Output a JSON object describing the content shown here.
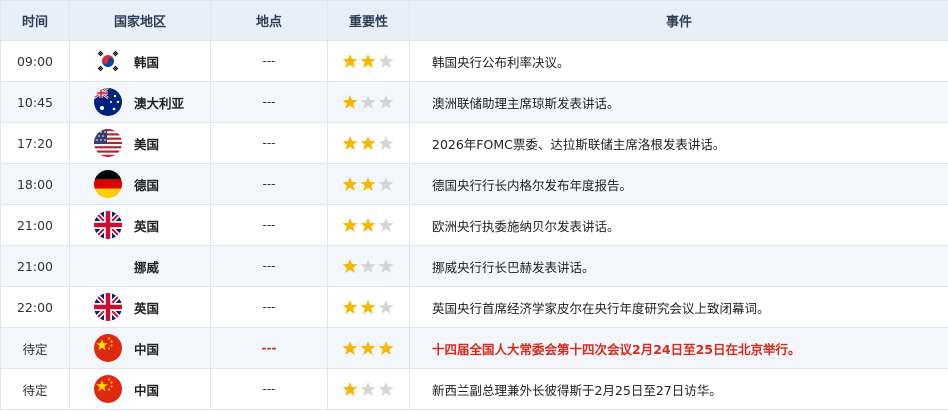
{
  "header": {
    "time": "时间",
    "country": "国家地区",
    "place": "地点",
    "importance": "重要性",
    "event": "事件"
  },
  "colors": {
    "star_on": "#f5b700",
    "star_off": "#d5d5d5",
    "highlight": "#d8291d",
    "header_bg": "#e7eff8"
  },
  "rows": [
    {
      "time": "09:00",
      "flag": "kr-flag-icon",
      "country": "韩国",
      "place": "---",
      "stars": 2,
      "event": "韩国央行公布利率决议。",
      "highlight": false
    },
    {
      "time": "10:45",
      "flag": "au-flag-icon",
      "country": "澳大利亚",
      "place": "---",
      "stars": 1,
      "event": "澳洲联储助理主席琼斯发表讲话。",
      "highlight": false
    },
    {
      "time": "17:20",
      "flag": "us-flag-icon",
      "country": "美国",
      "place": "---",
      "stars": 2,
      "event": "2026年FOMC票委、达拉斯联储主席洛根发表讲话。",
      "highlight": false
    },
    {
      "time": "18:00",
      "flag": "de-flag-icon",
      "country": "德国",
      "place": "---",
      "stars": 2,
      "event": "德国央行行长内格尔发布年度报告。",
      "highlight": false
    },
    {
      "time": "21:00",
      "flag": "uk-flag-icon",
      "country": "英国",
      "place": "---",
      "stars": 2,
      "event": "欧洲央行执委施纳贝尔发表讲话。",
      "highlight": false
    },
    {
      "time": "21:00",
      "flag": "",
      "country": "挪威",
      "place": "---",
      "stars": 1,
      "event": "挪威央行行长巴赫发表讲话。",
      "highlight": false
    },
    {
      "time": "22:00",
      "flag": "uk-flag-icon",
      "country": "英国",
      "place": "---",
      "stars": 2,
      "event": "英国央行首席经济学家皮尔在央行年度研究会议上致闭幕词。",
      "highlight": false
    },
    {
      "time": "待定",
      "flag": "cn-flag-icon",
      "country": "中国",
      "place": "---",
      "stars": 3,
      "event": "十四届全国人大常委会第十四次会议2月24日至25日在北京举行。",
      "highlight": true
    },
    {
      "time": "待定",
      "flag": "cn-flag-icon",
      "country": "中国",
      "place": "---",
      "stars": 1,
      "event": "新西兰副总理兼外长彼得斯于2月25日至27日访华。",
      "highlight": false
    }
  ]
}
